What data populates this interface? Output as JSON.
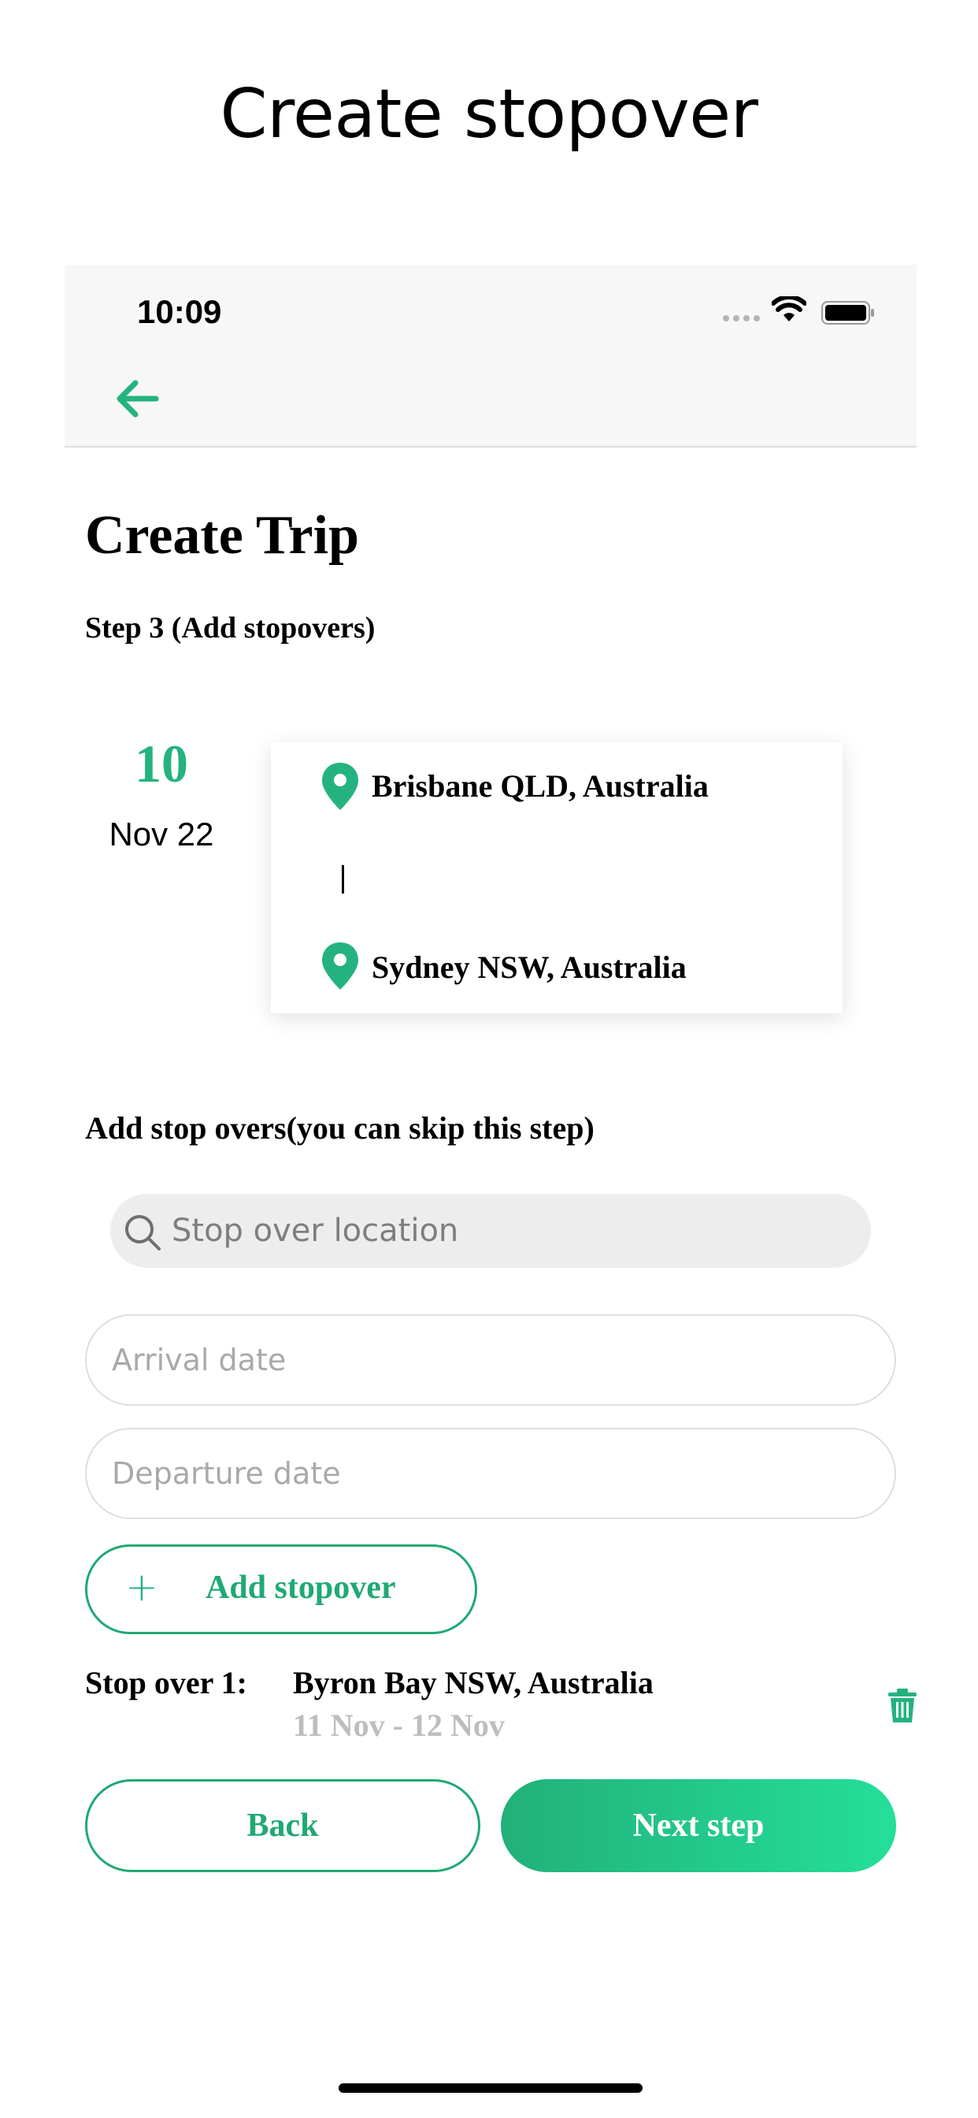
{
  "screen_title": "Create stopover",
  "status_bar": {
    "time": "10:09"
  },
  "header": {
    "back_icon": "arrow-left-icon"
  },
  "page": {
    "title": "Create Trip",
    "step": "Step 3 (Add stopovers)"
  },
  "trip": {
    "day": "10",
    "month_year": "Nov 22",
    "origin": "Brisbane QLD, Australia",
    "destination": "Sydney NSW, Australia",
    "divider": "|"
  },
  "stopover_form": {
    "heading": "Add stop overs(you can skip this step)",
    "search_placeholder": "Stop over location",
    "arrival_placeholder": "Arrival date",
    "departure_placeholder": "Departure date",
    "add_button_icon": "+",
    "add_button_label": "Add stopover"
  },
  "stopovers": [
    {
      "label": "Stop over 1:",
      "location": "Byron Bay NSW, Australia",
      "dates": "11 Nov - 12 Nov"
    }
  ],
  "actions": {
    "back": "Back",
    "next": "Next step"
  },
  "colors": {
    "accent": "#1fa974",
    "accent_light": "#24df9a",
    "muted_text": "#bdbdbd"
  }
}
